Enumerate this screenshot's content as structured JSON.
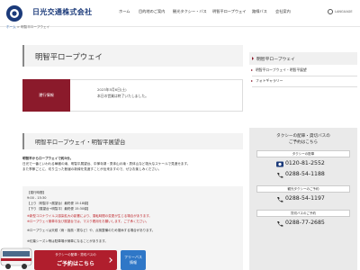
{
  "header": {
    "company_name": "日光交通株式会社",
    "nav": [
      "ホーム",
      "目的地のご案内",
      "観光タクシー・バス",
      "明智平ロープウェイ",
      "路線バス",
      "会社案内"
    ],
    "language_label": "LANGUAGE"
  },
  "breadcrumb": {
    "home": "ホーム",
    "separator": ">",
    "current": "明智平ロープウェイ"
  },
  "page_title": "明智平ロープウェイ",
  "status": {
    "label": "運行情報",
    "date": "2023年5月6日(土)",
    "message": "本日の営業は終了いたしました。"
  },
  "section": {
    "title": "明智平ロープウェイ・明智平展望台",
    "lead": "明智平からロープウェイで約3分。",
    "desc1": "日光で一番といわれる華厳の滝、明智平展望台、中禅寺湖・男体山の滝・男体山など雄大なスケールで見渡せます。",
    "desc2": "また季節ごとに、切り立った断崖の新緑を見渡すことが出来ますので、ぜひお楽しみください。"
  },
  "hours": {
    "heading": "【運行時間】",
    "time": "9:00 - 15:30",
    "up": "【上り（明智平→展望台）最終便 15:18頃】",
    "down": "【下り（展望台→明智平）最終便 15:30頃】",
    "note1": "※新型コロナウイルス感染拡大の影響により、運転時間の変更が生じる場合があります。",
    "note2": "※ロープウェイ乗車中及び展望台では、マスク着用をお願いします。ご了承ください。",
    "note3": "※ロープウェイは天候（雨・強風・霧など）や、点検整備のため運休する場合があります。",
    "note4": "※紅葉シーズン等は駐車場が満車になることがあります。"
  },
  "sidebar": {
    "heading": "明智平ロープウェイ",
    "links": [
      "明智平ロープウェイ・明智平展望",
      "フォトギャラリー"
    ]
  },
  "contact": {
    "title1": "タクシーの配車・貸切バスの",
    "title2": "ご予約はこちら",
    "sub1": "タクシーの配車",
    "phone1": "0120-81-2552",
    "phone2": "0288-54-1188",
    "sub2": "観光タクシーのご予約",
    "phone3": "0288-54-1197",
    "sub3": "貸切バスのご予約",
    "phone4": "0288-77-2685"
  },
  "banner": {
    "red_sub": "タクシーの配車・貸切バスの",
    "red_main": "ご予約はこちら",
    "blue_line1": "フリーバス",
    "blue_line2": "情報"
  },
  "colors": {
    "brand": "#1b3a7a",
    "accent_red": "#8b1a2b",
    "banner_red": "#b01e2d",
    "banner_blue": "#2f77c7"
  }
}
